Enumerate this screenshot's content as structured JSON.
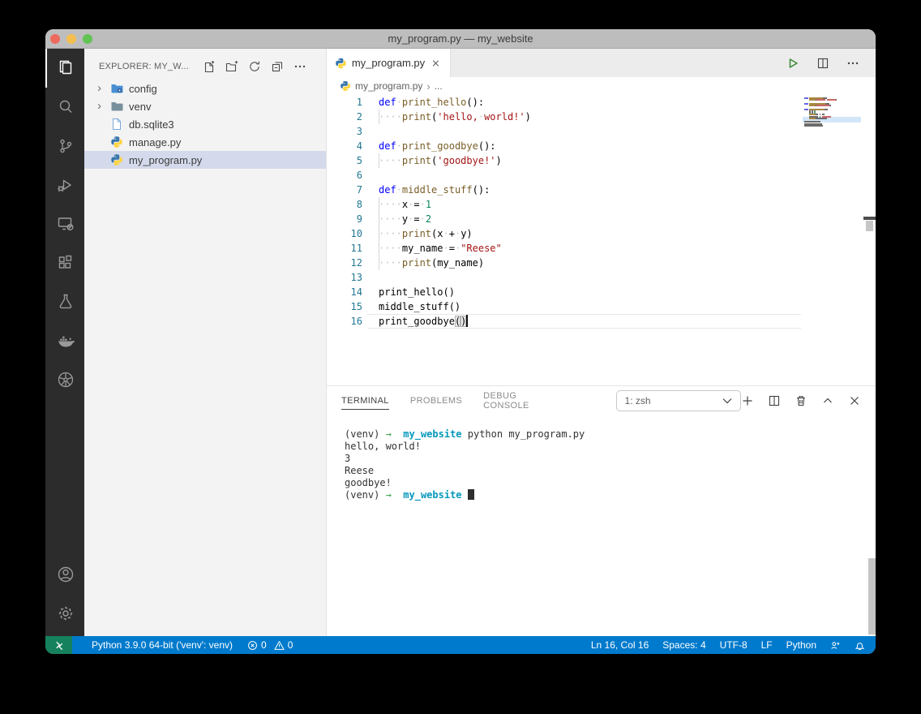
{
  "window": {
    "title": "my_program.py — my_website"
  },
  "activity_bar": {
    "items": [
      "explorer",
      "search",
      "source-control",
      "run-and-debug",
      "remote-explorer",
      "extensions",
      "testing",
      "docker",
      "kubernetes"
    ],
    "active": "explorer",
    "bottom": [
      "account",
      "settings"
    ]
  },
  "sidebar": {
    "header": "EXPLORER: MY_W...",
    "actions": [
      "new-file",
      "new-folder",
      "refresh-explorer",
      "collapse-folders",
      "more-actions"
    ],
    "files": [
      {
        "label": "config",
        "icon": "folderConfig",
        "chevron": true
      },
      {
        "label": "venv",
        "icon": "folder",
        "chevron": true
      },
      {
        "label": "db.sqlite3",
        "icon": "file"
      },
      {
        "label": "manage.py",
        "icon": "python"
      },
      {
        "label": "my_program.py",
        "icon": "python",
        "selected": true
      }
    ]
  },
  "editor": {
    "tab": {
      "label": "my_program.py"
    },
    "actions": [
      "run-python-file",
      "split-editor",
      "more-actions"
    ],
    "breadcrumb": {
      "file": "my_program.py",
      "separator": "›",
      "symbol": "..."
    },
    "code": {
      "language": "python",
      "lines": [
        {
          "n": "1",
          "t": [
            [
              "kw",
              "def"
            ],
            [
              "ws",
              "·"
            ],
            [
              "fn",
              "print_hello"
            ],
            [
              "pl",
              "():"
            ]
          ]
        },
        {
          "n": "2",
          "g": 1,
          "t": [
            [
              "ws",
              "····"
            ],
            [
              "fn",
              "print"
            ],
            [
              "pl",
              "("
            ],
            [
              "str",
              "'hello,"
            ],
            [
              "ws",
              "·"
            ],
            [
              "str",
              "world!'"
            ],
            [
              "pl",
              ")"
            ]
          ]
        },
        {
          "n": "3",
          "t": []
        },
        {
          "n": "4",
          "t": [
            [
              "kw",
              "def"
            ],
            [
              "ws",
              "·"
            ],
            [
              "fn",
              "print_goodbye"
            ],
            [
              "pl",
              "():"
            ]
          ]
        },
        {
          "n": "5",
          "g": 1,
          "t": [
            [
              "ws",
              "····"
            ],
            [
              "fn",
              "print"
            ],
            [
              "pl",
              "("
            ],
            [
              "str",
              "'goodbye!'"
            ],
            [
              "pl",
              ")"
            ]
          ]
        },
        {
          "n": "6",
          "t": []
        },
        {
          "n": "7",
          "t": [
            [
              "kw",
              "def"
            ],
            [
              "ws",
              "·"
            ],
            [
              "fn",
              "middle_stuff"
            ],
            [
              "pl",
              "():"
            ]
          ]
        },
        {
          "n": "8",
          "g": 1,
          "t": [
            [
              "ws",
              "····"
            ],
            [
              "pl",
              "x"
            ],
            [
              "ws",
              "·"
            ],
            [
              "pl",
              "="
            ],
            [
              "ws",
              "·"
            ],
            [
              "num",
              "1"
            ]
          ]
        },
        {
          "n": "9",
          "g": 1,
          "t": [
            [
              "ws",
              "····"
            ],
            [
              "pl",
              "y"
            ],
            [
              "ws",
              "·"
            ],
            [
              "pl",
              "="
            ],
            [
              "ws",
              "·"
            ],
            [
              "num",
              "2"
            ]
          ]
        },
        {
          "n": "10",
          "g": 1,
          "t": [
            [
              "ws",
              "····"
            ],
            [
              "fn",
              "print"
            ],
            [
              "pl",
              "(x"
            ],
            [
              "ws",
              "·"
            ],
            [
              "pl",
              "+"
            ],
            [
              "ws",
              "·"
            ],
            [
              "pl",
              "y)"
            ]
          ]
        },
        {
          "n": "11",
          "g": 1,
          "t": [
            [
              "ws",
              "····"
            ],
            [
              "pl",
              "my_name"
            ],
            [
              "ws",
              "·"
            ],
            [
              "pl",
              "="
            ],
            [
              "ws",
              "·"
            ],
            [
              "str",
              "\"Reese\""
            ]
          ]
        },
        {
          "n": "12",
          "g": 1,
          "t": [
            [
              "ws",
              "····"
            ],
            [
              "fn",
              "print"
            ],
            [
              "pl",
              "(my_name)"
            ]
          ]
        },
        {
          "n": "13",
          "t": []
        },
        {
          "n": "14",
          "t": [
            [
              "pl",
              "print_hello()"
            ]
          ]
        },
        {
          "n": "15",
          "t": [
            [
              "pl",
              "middle_stuff()"
            ]
          ]
        },
        {
          "n": "16",
          "current": 1,
          "caret": 1,
          "t": [
            [
              "pl",
              "print_goodbye"
            ],
            [
              "bm",
              "("
            ],
            [
              "bm",
              ")"
            ]
          ]
        }
      ]
    }
  },
  "panel": {
    "tabs": [
      {
        "label": "TERMINAL",
        "active": true
      },
      {
        "label": "PROBLEMS"
      },
      {
        "label": "DEBUG CONSOLE"
      }
    ],
    "dropdown": {
      "value": "1: zsh"
    },
    "actions": [
      "new-terminal",
      "split-terminal",
      "kill-terminal",
      "maximize-panel",
      "close-panel"
    ],
    "terminal": {
      "lines": [
        [
          [
            "d",
            "(venv) "
          ],
          [
            "g",
            "→"
          ],
          [
            "d",
            "  "
          ],
          [
            "c",
            "my_website"
          ],
          [
            "d",
            " python my_program.py"
          ]
        ],
        [
          [
            "d",
            "hello, world!"
          ]
        ],
        [
          [
            "d",
            "3"
          ]
        ],
        [
          [
            "d",
            "Reese"
          ]
        ],
        [
          [
            "d",
            "goodbye!"
          ]
        ],
        [
          [
            "d",
            "(venv) "
          ],
          [
            "g",
            "→"
          ],
          [
            "d",
            "  "
          ],
          [
            "c",
            "my_website"
          ],
          [
            "d",
            " "
          ],
          [
            "cur",
            ""
          ]
        ]
      ]
    }
  },
  "status_bar": {
    "left": {
      "python_interpreter": "Python 3.9.0 64-bit ('venv': venv)",
      "errors": "0",
      "warnings": "0"
    },
    "right": {
      "cursor": "Ln 16, Col 16",
      "spaces": "Spaces: 4",
      "encoding": "UTF-8",
      "eol": "LF",
      "language": "Python"
    }
  },
  "colors": {
    "status_bar": "#007ACC",
    "remote_indicator": "#16825D",
    "keyword": "#0000FF",
    "function": "#795E26",
    "string": "#A31515",
    "number": "#098658",
    "terminal_cyan": "#0598BC",
    "terminal_green": "#37A24A",
    "run_button": "#388A34"
  }
}
